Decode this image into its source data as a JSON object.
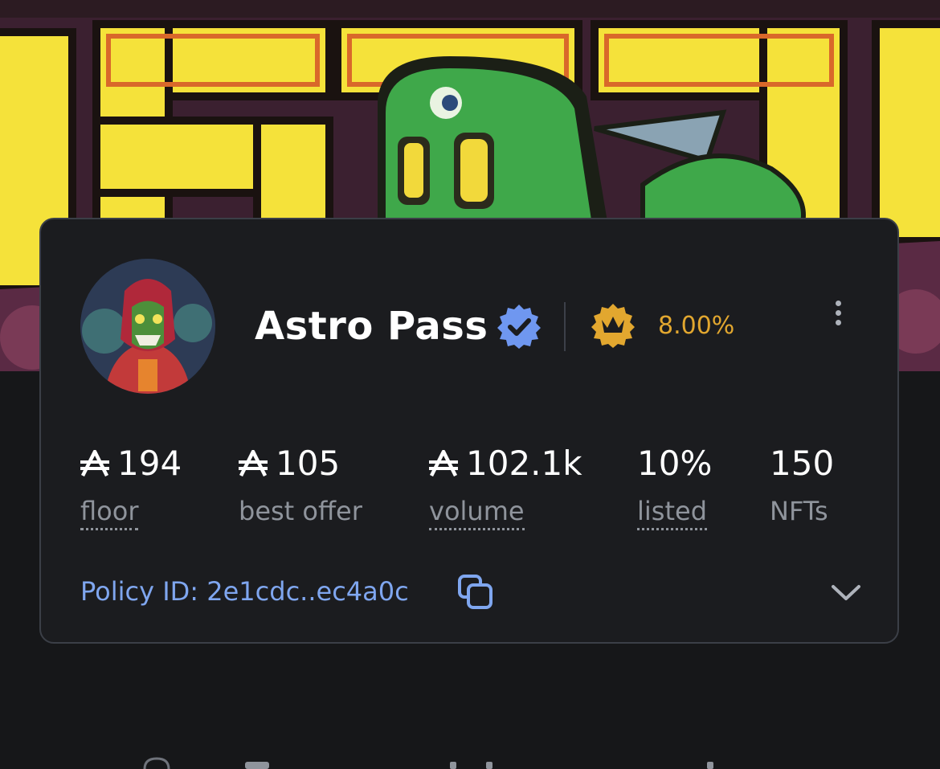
{
  "collection": {
    "name": "Astro Pass",
    "royalty": "8.00%"
  },
  "stats": [
    {
      "value": "194",
      "label": "floor",
      "currency": true,
      "dotted": true
    },
    {
      "value": "105",
      "label": "best offer",
      "currency": true,
      "dotted": false
    },
    {
      "value": "102.1k",
      "label": "volume",
      "currency": true,
      "dotted": true
    },
    {
      "value": "10%",
      "label": "listed",
      "currency": false,
      "dotted": true
    },
    {
      "value": "150",
      "label": "NFTs",
      "currency": false,
      "dotted": false
    }
  ],
  "policy": {
    "text": "Policy ID: 2e1cdc..ec4a0c"
  },
  "icons": {
    "verified": "verified-badge-icon",
    "royalty": "crown-badge-icon",
    "more": "more-vertical-icon",
    "copy": "copy-icon",
    "expand": "chevron-down-icon",
    "currency": "ada-icon"
  },
  "colors": {
    "background": "#161719",
    "card": "#1b1c1f",
    "border": "#3b3f47",
    "accent_blue": "#7fa6ef",
    "verified_blue": "#6f97f0",
    "royalty_gold": "#e2a72f",
    "muted_text": "#8f949c"
  }
}
